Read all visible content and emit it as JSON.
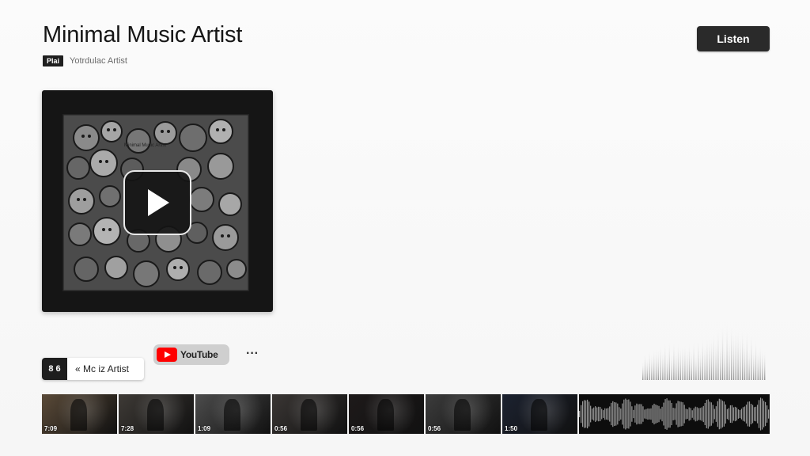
{
  "header": {
    "title": "Minimal Music Artist",
    "listen_label": "Listen",
    "badge": "Plai",
    "subtitle": "Yotrdulac Artist"
  },
  "album": {
    "caption": "Minimal Music Artist",
    "play_icon": "play-icon"
  },
  "actions": {
    "artist_count": "8 6",
    "artist_name": "« Mc iz Artist",
    "youtube_label": "YouTube",
    "more_label": "···"
  },
  "videos": [
    {
      "duration": "7:09",
      "color": "#5a4a38"
    },
    {
      "duration": "7:28",
      "color": "#3e3a36"
    },
    {
      "duration": "1:09",
      "color": "#4c4c4c"
    },
    {
      "duration": "0:56",
      "color": "#3a3634"
    },
    {
      "duration": "0:56",
      "color": "#1e1a1a"
    },
    {
      "duration": "0:56",
      "color": "#3c3c3c"
    },
    {
      "duration": "1:50",
      "color": "#1c2230"
    }
  ]
}
